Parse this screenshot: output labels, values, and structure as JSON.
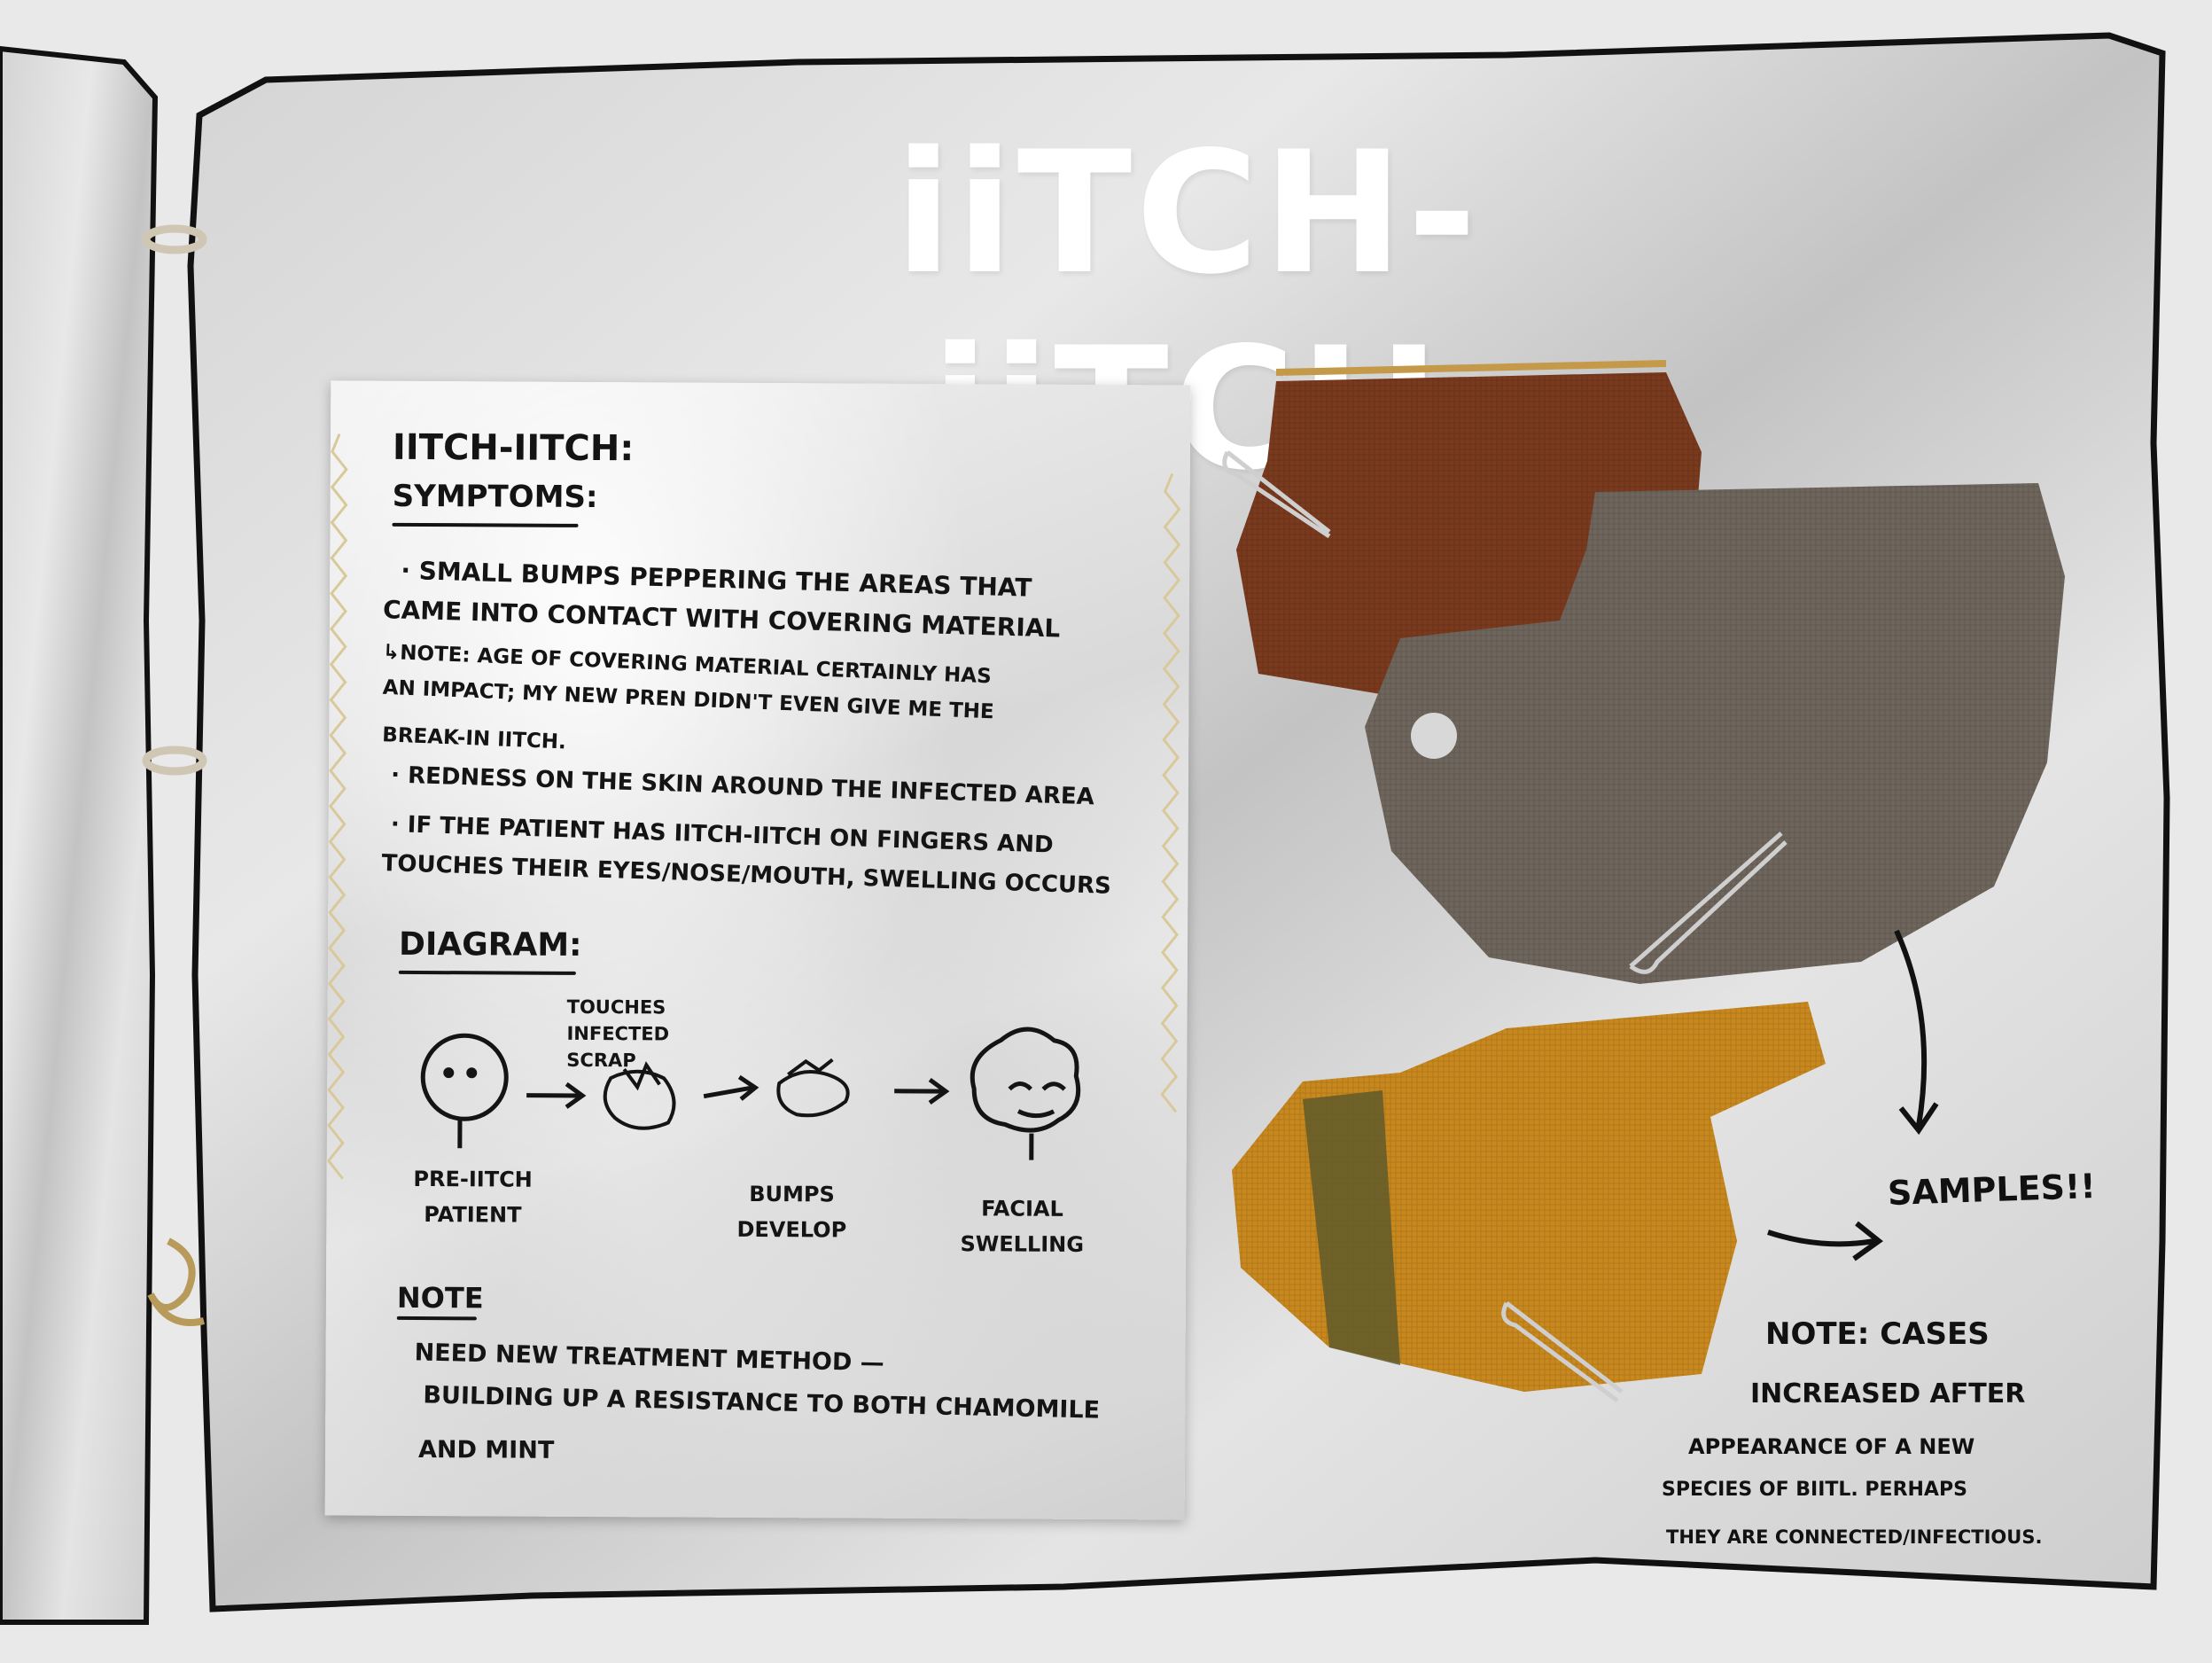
{
  "title": "iiTCH-iiTCH",
  "notes": {
    "heading": "iiTCH-iiTCH:",
    "symptoms_heading": "SYMPTOMS:",
    "symptom_1_line_1": "· SMALL BUMPS PEPPERING THE AREAS THAT",
    "symptom_1_line_2": "CAME INTO CONTACT WITH COVERING MATERIAL",
    "sub_note_line_1": "↳NOTE: AGE OF COVERING MATERIAL CERTAINLY HAS",
    "sub_note_line_2": "AN IMPACT; MY NEW PREN DIDN'T EVEN GIVE ME THE",
    "sub_note_line_3": "BREAK-IN iiTCH.",
    "symptom_2": "· REDNESS ON THE SKIN AROUND THE INFECTED AREA",
    "symptom_3_line_1": "· IF THE PATIENT HAS iiTCH-iiTCH ON FINGERS AND",
    "symptom_3_line_2": "TOUCHES THEIR EYES/NOSE/MOUTH, SWELLING OCCURS",
    "diagram_heading": "DIAGRAM:",
    "diagram": {
      "step_1": "PRE-iiTCH PATIENT",
      "step_2": "TOUCHES INFECTED SCRAP",
      "step_3": "BUMPS DEVELOP",
      "step_4": "FACIAL SWELLING"
    },
    "note_heading": "NOTE",
    "note_line_1": "NEED NEW TREATMENT METHOD —",
    "note_line_2": "BUILDING UP A RESISTANCE TO BOTH CHAMOMILE",
    "note_line_3": "AND MINT"
  },
  "samples_label": "SAMPLES!!",
  "side_note": {
    "line_1": "NOTE: CASES",
    "line_2": "INCREASED AFTER",
    "line_3": "APPEARANCE OF A NEW",
    "line_4": "SPECIES OF BIITL. PERHAPS",
    "line_5": "THEY ARE CONNECTED/INFECTIOUS."
  },
  "colors": {
    "ink": "#141414",
    "title": "#ffffff",
    "fabric_red": "#7a3a1e",
    "fabric_grey": "#6e655c",
    "fabric_mustard": "#c8881e",
    "fabric_olive": "#5f5a2a"
  }
}
